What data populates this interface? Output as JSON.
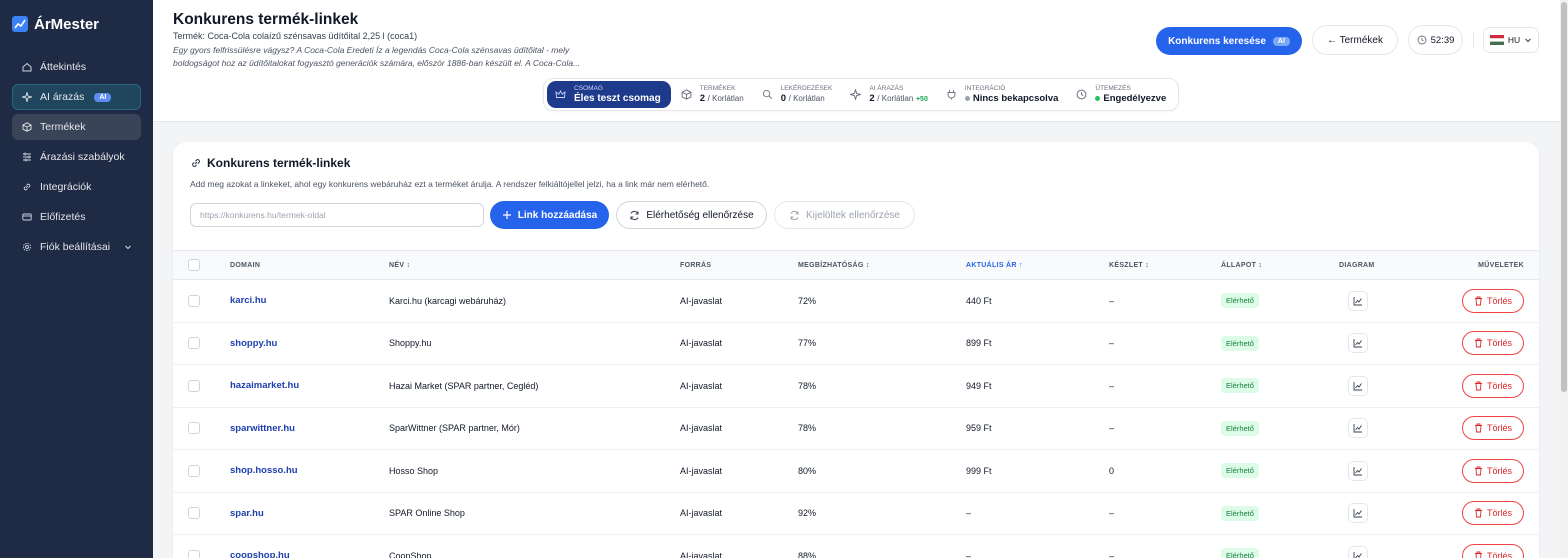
{
  "app": {
    "name": "ÁrMester"
  },
  "sidebar": {
    "items": [
      {
        "label": "Áttekintés",
        "icon": "home-icon"
      },
      {
        "label": "AI árazás",
        "icon": "sparkle-icon",
        "badge": "AI"
      },
      {
        "label": "Termékek",
        "icon": "box-icon"
      },
      {
        "label": "Árazási szabályok",
        "icon": "sliders-icon"
      },
      {
        "label": "Integrációk",
        "icon": "link-icon"
      },
      {
        "label": "Előfizetés",
        "icon": "credit-card-icon"
      },
      {
        "label": "Fiók beállításai",
        "icon": "gear-icon"
      }
    ]
  },
  "header": {
    "title": "Konkurens termék-linkek",
    "product_line": "Termék: Coca-Cola colaízű szénsavas üdítőital 2,25 l (coca1)",
    "description": "Egy gyors felfrissülésre vágysz? A Coca-Cola Eredeti Íz a legendás Coca-Cola szénsavas üdítőital - mely boldogságot hoz az üdítőitalokat fogyasztó generációk számára, először 1886-ban készült el. A Coca-Cola...",
    "search_competitors_label": "Konkurens keresése",
    "ai_badge": "AI",
    "back_label": "← Termékek",
    "timer": "52:39",
    "language": "HU"
  },
  "stats": {
    "package": {
      "label": "CSOMAG",
      "value": "Éles teszt csomag"
    },
    "products": {
      "label": "TERMÉKEK",
      "value": "2",
      "limit": "/ Korlátlan"
    },
    "queries": {
      "label": "LEKÉRDEZÉSEK",
      "value": "0",
      "limit": "/ Korlátlan"
    },
    "ai_pricing": {
      "label": "AI ÁRAZÁS",
      "value": "2",
      "limit": "/ Korlátlan",
      "extra": "+50"
    },
    "integration": {
      "label": "INTEGRÁCIÓ",
      "value": "Nincs bekapcsolva",
      "status_color": "#9ca3af"
    },
    "schedule": {
      "label": "ÜTEMEZÉS",
      "value": "Engedélyezve",
      "status_color": "#22c55e"
    }
  },
  "card": {
    "title": "Konkurens termék-linkek",
    "description": "Add meg azokat a linkeket, ahol egy konkurens webáruház ezt a terméket árulja. A rendszer felkiáltójellel jelzi, ha a link már nem elérhető.",
    "url_placeholder": "https://konkurens.hu/termek-oldal",
    "add_link_label": "Link hozzáadása",
    "check_label": "Elérhetőség ellenőrzése",
    "check_selected_label": "Kijelöltek ellenőrzése"
  },
  "table": {
    "columns": {
      "domain": "DOMAIN",
      "name": "NÉV ↕",
      "source": "FORRÁS",
      "reliability": "MEGBÍZHATÓSÁG ↕",
      "price": "AKTUÁLIS ÁR ↑",
      "stock": "KÉSZLET ↕",
      "status": "ÁLLAPOT ↕",
      "diagram": "DIAGRAM",
      "actions": "MŰVELETEK"
    },
    "delete_label": "Törlés",
    "rows": [
      {
        "domain": "karci.hu",
        "name": "Karci.hu (karcagi webáruház)",
        "source": "AI-javaslat",
        "reliability": "72%",
        "price": "440 Ft",
        "stock": "–",
        "status": "Elérhető"
      },
      {
        "domain": "shoppy.hu",
        "name": "Shoppy.hu",
        "source": "AI-javaslat",
        "reliability": "77%",
        "price": "899 Ft",
        "stock": "–",
        "status": "Elérhető"
      },
      {
        "domain": "hazaimarket.hu",
        "name": "Hazai Market (SPAR partner, Cegléd)",
        "source": "AI-javaslat",
        "reliability": "78%",
        "price": "949 Ft",
        "stock": "–",
        "status": "Elérhető"
      },
      {
        "domain": "sparwittner.hu",
        "name": "SparWittner (SPAR partner, Mór)",
        "source": "AI-javaslat",
        "reliability": "78%",
        "price": "959 Ft",
        "stock": "–",
        "status": "Elérhető"
      },
      {
        "domain": "shop.hosso.hu",
        "name": "Hosso Shop",
        "source": "AI-javaslat",
        "reliability": "80%",
        "price": "999 Ft",
        "stock": "0",
        "status": "Elérhető"
      },
      {
        "domain": "spar.hu",
        "name": "SPAR Online Shop",
        "source": "AI-javaslat",
        "reliability": "92%",
        "price": "–",
        "stock": "–",
        "status": "Elérhető"
      },
      {
        "domain": "coopshop.hu",
        "name": "CoopShop",
        "source": "AI-javaslat",
        "reliability": "88%",
        "price": "–",
        "stock": "–",
        "status": "Elérhető"
      }
    ]
  },
  "colors": {
    "sidebar": "#1f2a44",
    "accent": "#2563eb",
    "success": "#15803d",
    "danger": "#dc2626"
  }
}
